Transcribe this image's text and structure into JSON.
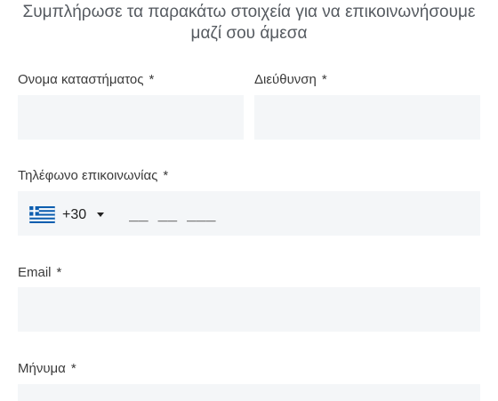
{
  "form": {
    "headline_line1": "Συμπλήρωσε τα παρακάτω στοιχεία για να επικοινωνήσουμε",
    "headline_line2": "μαζί σου άμεσα",
    "required_mark": "*",
    "store_name": {
      "label": "Ονομα καταστήματος",
      "value": ""
    },
    "address": {
      "label": "Διεύθυνση",
      "value": ""
    },
    "phone": {
      "label": "Τηλέφωνο επικοινωνίας",
      "country_flag": "greece-flag-icon",
      "dial_code": "+30",
      "mask": "__ __ ___"
    },
    "email": {
      "label": "Email",
      "value": ""
    },
    "message": {
      "label": "Μήνυμα",
      "value": ""
    }
  },
  "colors": {
    "field_background": "#f4f6f8",
    "flag_blue": "#0d5eaf",
    "text": "#333333"
  }
}
